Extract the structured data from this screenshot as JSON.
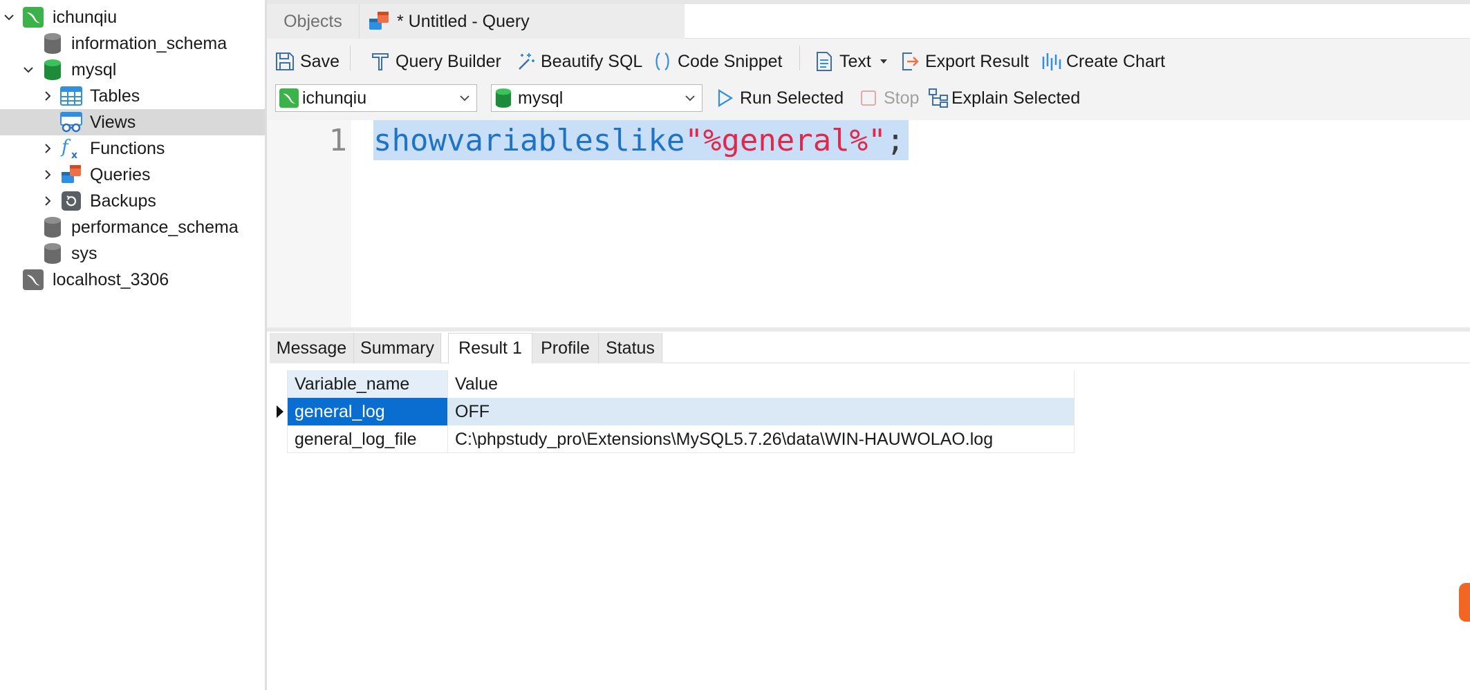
{
  "sidebar": {
    "items": [
      {
        "label": "ichunqiu",
        "icon": "mysql-connection-icon",
        "expanded": true
      },
      {
        "label": "information_schema",
        "icon": "database-icon"
      },
      {
        "label": "mysql",
        "icon": "database-icon",
        "expanded": true
      },
      {
        "label": "Tables",
        "icon": "tables-icon"
      },
      {
        "label": "Views",
        "icon": "views-icon",
        "selected": true
      },
      {
        "label": "Functions",
        "icon": "functions-icon"
      },
      {
        "label": "Queries",
        "icon": "queries-icon"
      },
      {
        "label": "Backups",
        "icon": "backups-icon"
      },
      {
        "label": "performance_schema",
        "icon": "database-icon"
      },
      {
        "label": "sys",
        "icon": "database-icon"
      },
      {
        "label": "localhost_3306",
        "icon": "mysql-connection-icon"
      }
    ]
  },
  "tabs": {
    "objects": "Objects",
    "query": "* Untitled - Query"
  },
  "toolbar": {
    "save": "Save",
    "query_builder": "Query Builder",
    "beautify_sql": "Beautify SQL",
    "code_snippet": "Code Snippet",
    "text": "Text",
    "export_result": "Export Result",
    "create_chart": "Create Chart",
    "run_selected": "Run Selected",
    "stop": "Stop",
    "explain_selected": "Explain Selected"
  },
  "selectors": {
    "connection": "ichunqiu",
    "database": "mysql"
  },
  "editor": {
    "line_number": "1",
    "tokens": {
      "kw1": "show",
      "kw2": "variables",
      "kw3": "like",
      "str": "\"%general%\"",
      "end": ";"
    }
  },
  "result_tabs": [
    "Message",
    "Summary",
    "Result 1",
    "Profile",
    "Status"
  ],
  "active_result_tab": "Result 1",
  "grid": {
    "columns": [
      "Variable_name",
      "Value"
    ],
    "rows": [
      [
        "general_log",
        "OFF"
      ],
      [
        "general_log_file",
        "C:\\phpstudy_pro\\Extensions\\MySQL5.7.26\\data\\WIN-HAUWOLAO.log"
      ]
    ]
  },
  "colors": {
    "accent": "#0a6ed1",
    "keyword": "#1f73c7",
    "string": "#e0284d",
    "selection": "#c8dff7"
  }
}
